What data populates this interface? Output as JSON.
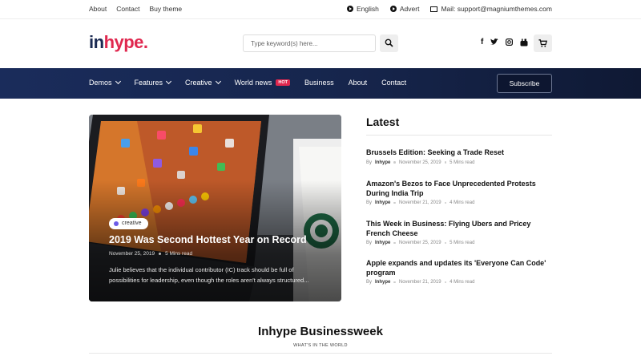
{
  "topbar": {
    "links": [
      "About",
      "Contact",
      "Buy theme"
    ],
    "language": "English",
    "advert": "Advert",
    "mail": "Mail: support@magniumthemes.com"
  },
  "header": {
    "logo_part1": "in",
    "logo_part2": "hype.",
    "search_placeholder": "Type keyword(s) here...",
    "social_icons": [
      "facebook-icon",
      "twitter-icon",
      "instagram-icon",
      "youtube-icon"
    ]
  },
  "nav": {
    "items": [
      {
        "label": "Demos",
        "dropdown": true
      },
      {
        "label": "Features",
        "dropdown": true
      },
      {
        "label": "Creative",
        "dropdown": true
      },
      {
        "label": "World news",
        "badge": "HOT"
      },
      {
        "label": "Business"
      },
      {
        "label": "About"
      },
      {
        "label": "Contact"
      }
    ],
    "subscribe": "Subscribe"
  },
  "featured": {
    "category": "creative",
    "title": "2019 Was Second Hottest Year on Record",
    "date": "November 25, 2019",
    "read_time": "5 Mins read",
    "excerpt": "Julie believes that the individual contributor (IC) track should be full of possibilities for leadership, even though the roles aren't always structured..."
  },
  "latest": {
    "heading": "Latest",
    "posts": [
      {
        "title": "Brussels Edition: Seeking a Trade Reset",
        "by": "By",
        "author": "Inhype",
        "date": "November 25, 2019",
        "read": "5 Mins read"
      },
      {
        "title": "Amazon's Bezos to Face Unprecedented Protests During India Trip",
        "by": "By",
        "author": "Inhype",
        "date": "November 21, 2019",
        "read": "4 Mins read"
      },
      {
        "title": "This Week in Business: Flying Ubers and Pricey French Cheese",
        "by": "By",
        "author": "Inhype",
        "date": "November 25, 2019",
        "read": "5 Mins read"
      },
      {
        "title": "Apple expands and updates its 'Everyone Can Code' program",
        "by": "By",
        "author": "Inhype",
        "date": "November 21, 2019",
        "read": "4 Mins read"
      }
    ]
  },
  "section": {
    "title": "Inhype Businessweek",
    "subtitle": "WHAT'S IN THE WORLD"
  },
  "colors": {
    "brand_navy": "#1b2a52",
    "brand_pink": "#e0284f",
    "nav_bg": "#16254c"
  }
}
